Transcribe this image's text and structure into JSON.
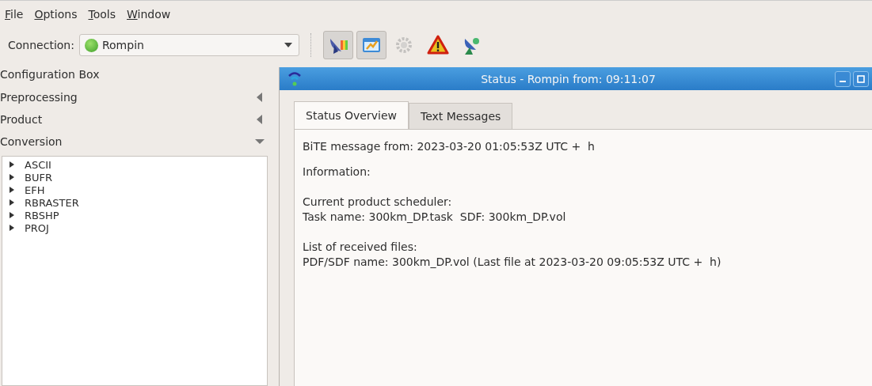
{
  "menu": [
    "File",
    "Options",
    "Tools",
    "Window"
  ],
  "toolbar": {
    "connection_label": "Connection:",
    "connection_value": "Rompin",
    "tools": [
      {
        "kind": "satellite",
        "pressed": true,
        "disabled": false
      },
      {
        "kind": "chart",
        "pressed": true,
        "disabled": false
      },
      {
        "kind": "gear",
        "pressed": false,
        "disabled": true
      },
      {
        "kind": "warning",
        "pressed": false,
        "disabled": false
      },
      {
        "kind": "dish",
        "pressed": false,
        "disabled": false
      }
    ]
  },
  "config_box": {
    "title": "Configuration Box",
    "sections": [
      {
        "label": "Preprocessing",
        "expanded": false
      },
      {
        "label": "Product",
        "expanded": false
      },
      {
        "label": "Conversion",
        "expanded": true
      }
    ],
    "tree": [
      {
        "label": "ASCII",
        "expanded": false
      },
      {
        "label": "BUFR",
        "expanded": false
      },
      {
        "label": "EFH",
        "expanded": false
      },
      {
        "label": "RBRASTER",
        "expanded": false
      },
      {
        "label": "RBSHP",
        "expanded": false
      },
      {
        "label": "PROJ",
        "expanded": false
      }
    ]
  },
  "status_window": {
    "title": "Status - Rompin from: 09:11:07",
    "tabs": [
      {
        "label": "Status Overview",
        "selected": true
      },
      {
        "label": "Text Messages",
        "selected": false
      }
    ],
    "paragraphs": [
      [
        "BiTE message from: 2023-03-20 01:05:53Z UTC +  h"
      ],
      [
        "Information:"
      ],
      [
        "Current product scheduler:",
        "Task name: 300km_DP.task  SDF: 300km_DP.vol"
      ],
      [
        "List of received files:",
        "PDF/SDF name: 300km_DP.vol (Last file at 2023-03-20 09:05:53Z UTC +  h)"
      ]
    ]
  }
}
